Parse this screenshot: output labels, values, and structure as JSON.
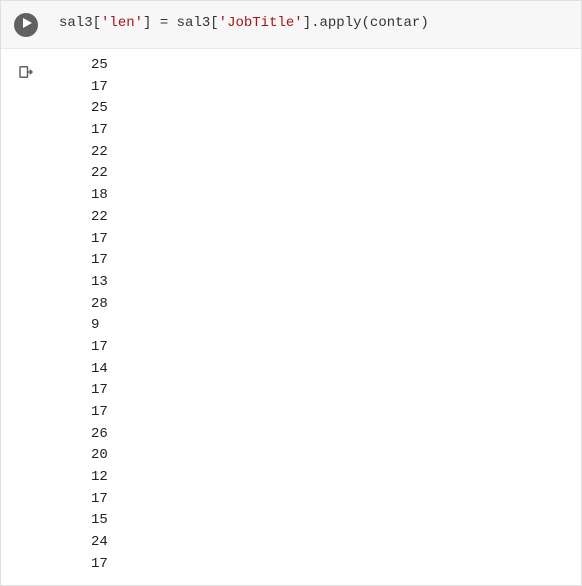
{
  "code": {
    "tokens": [
      {
        "text": "sal3",
        "cls": "tok-var"
      },
      {
        "text": "[",
        "cls": "tok-bracket"
      },
      {
        "text": "'len'",
        "cls": "tok-string"
      },
      {
        "text": "]",
        "cls": "tok-bracket"
      },
      {
        "text": " ",
        "cls": "tok-op"
      },
      {
        "text": "=",
        "cls": "tok-op"
      },
      {
        "text": " ",
        "cls": "tok-op"
      },
      {
        "text": "sal3",
        "cls": "tok-var"
      },
      {
        "text": "[",
        "cls": "tok-bracket"
      },
      {
        "text": "'JobTitle'",
        "cls": "tok-string"
      },
      {
        "text": "]",
        "cls": "tok-bracket"
      },
      {
        "text": ".",
        "cls": "tok-op"
      },
      {
        "text": "apply",
        "cls": "tok-method"
      },
      {
        "text": "(",
        "cls": "tok-bracket"
      },
      {
        "text": "contar",
        "cls": "tok-var"
      },
      {
        "text": ")",
        "cls": "tok-bracket"
      }
    ]
  },
  "output": {
    "lines": [
      "25",
      "17",
      "25",
      "17",
      "22",
      "22",
      "18",
      "22",
      "17",
      "17",
      "13",
      "28",
      "9",
      "17",
      "14",
      "17",
      "17",
      "26",
      "20",
      "12",
      "17",
      "15",
      "24",
      "17"
    ]
  }
}
